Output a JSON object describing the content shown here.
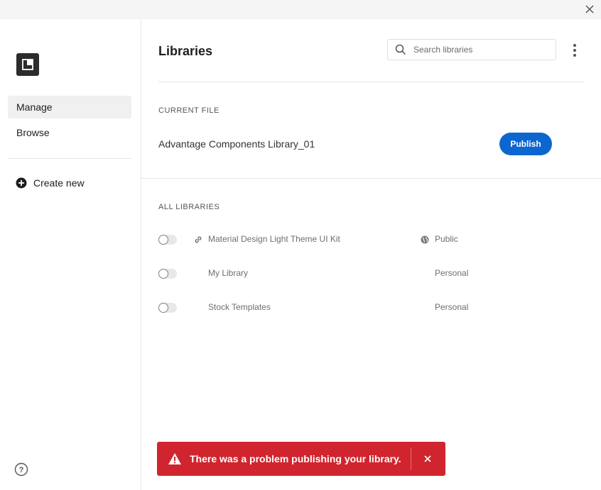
{
  "window": {
    "close_icon": "close-icon"
  },
  "sidebar": {
    "logo_icon": "library-logo-icon",
    "items": [
      {
        "label": "Manage",
        "active": true
      },
      {
        "label": "Browse",
        "active": false
      }
    ],
    "create_new": {
      "label": "Create new",
      "icon": "plus-circle-icon"
    },
    "help_icon": "help-icon"
  },
  "header": {
    "title": "Libraries",
    "search": {
      "placeholder": "Search libraries",
      "value": "",
      "icon": "search-icon"
    },
    "more_icon": "more-vertical-icon"
  },
  "current_file": {
    "section_label": "CURRENT FILE",
    "file_name": "Advantage Components Library_01",
    "publish_label": "Publish"
  },
  "all_libraries": {
    "section_label": "ALL LIBRARIES",
    "rows": [
      {
        "name": "Material Design Light Theme UI Kit",
        "type": "Public",
        "enabled": false,
        "has_link_icon": true,
        "has_globe_icon": true
      },
      {
        "name": "My Library",
        "type": "Personal",
        "enabled": false,
        "has_link_icon": false,
        "has_globe_icon": false
      },
      {
        "name": "Stock Templates",
        "type": "Personal",
        "enabled": false,
        "has_link_icon": false,
        "has_globe_icon": false
      }
    ]
  },
  "toast": {
    "message": "There was a problem publishing your library.",
    "icon": "alert-triangle-icon",
    "close_icon": "close-icon",
    "color": "#d0252e"
  },
  "colors": {
    "accent": "#0d66d0",
    "error": "#d0252e"
  }
}
